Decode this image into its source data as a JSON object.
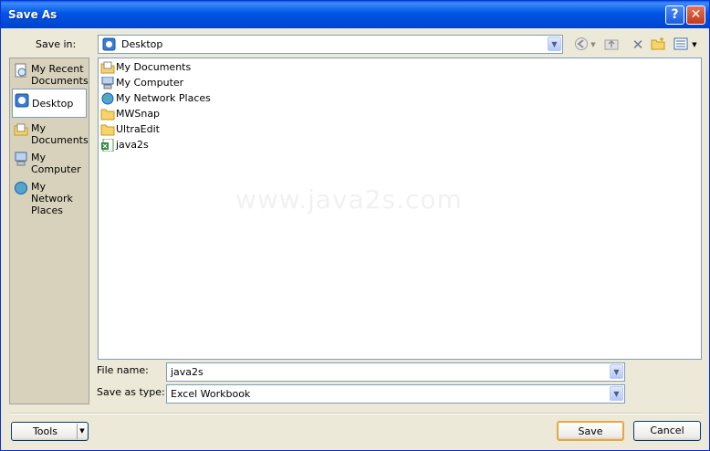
{
  "window": {
    "title": "Save As",
    "help_label": "?",
    "close_label": "✕"
  },
  "save_in": {
    "label": "Save in:",
    "value": "Desktop"
  },
  "toolbar": {
    "icons": [
      "back-icon",
      "up-folder-icon",
      "delete-icon",
      "new-folder-icon",
      "views-icon"
    ]
  },
  "places": [
    {
      "label": "My Recent Documents",
      "icon": "recent-docs-icon"
    },
    {
      "label": "Desktop",
      "icon": "desktop-icon"
    },
    {
      "label": "My Documents",
      "icon": "my-documents-icon"
    },
    {
      "label": "My Computer",
      "icon": "my-computer-icon"
    },
    {
      "label": "My Network Places",
      "icon": "network-places-icon"
    }
  ],
  "files": [
    {
      "name": "My Documents",
      "icon": "my-documents-icon"
    },
    {
      "name": "My Computer",
      "icon": "my-computer-icon"
    },
    {
      "name": "My Network Places",
      "icon": "network-places-icon"
    },
    {
      "name": "MWSnap",
      "icon": "folder-icon"
    },
    {
      "name": "UltraEdit",
      "icon": "folder-icon"
    },
    {
      "name": "java2s",
      "icon": "excel-file-icon"
    }
  ],
  "watermark": "www.java2s.com",
  "file_name": {
    "label": "File name:",
    "value": "java2s"
  },
  "save_as_type": {
    "label": "Save as type:",
    "value": "Excel Workbook"
  },
  "buttons": {
    "tools": "Tools",
    "save": "Save",
    "cancel": "Cancel"
  }
}
